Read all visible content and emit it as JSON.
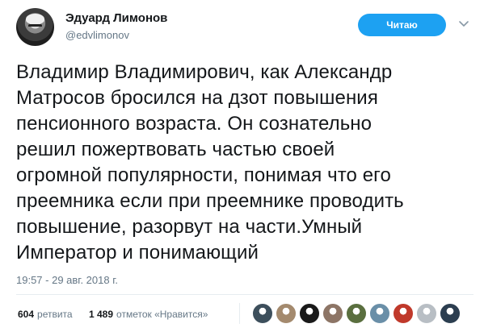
{
  "author": {
    "name": "Эдуард Лимонов",
    "handle": "@edvlimonov"
  },
  "follow_button": {
    "label": "Читаю",
    "color": "#1da1f2"
  },
  "tweet": {
    "lines": [
      "Владимир Владимирович, как Александр",
      "Матросов бросился на дзот повышения",
      "пенсионного возраста. Он сознательно",
      "решил пожертвовать частью своей",
      "огромной популярности, понимая что его",
      "преемника если при преемнике проводить",
      "повышение, разорвут на части.Умный",
      "Император и понимающий"
    ],
    "timestamp": "19:57 - 29 авг. 2018 г."
  },
  "stats": {
    "retweets_count": "604",
    "retweets_label": "ретвита",
    "likes_count": "1 489",
    "likes_label": "отметок «Нравится»"
  },
  "likers": [
    {
      "icon": "avatar-icon",
      "color": "#3d4f5c"
    },
    {
      "icon": "avatar-icon",
      "color": "#a48a6e"
    },
    {
      "icon": "avatar-icon",
      "color": "#1a1a1a"
    },
    {
      "icon": "avatar-icon",
      "color": "#8d7566"
    },
    {
      "icon": "avatar-icon",
      "color": "#5a6f3f"
    },
    {
      "icon": "avatar-icon",
      "color": "#6a8fa8"
    },
    {
      "icon": "avatar-icon",
      "color": "#c0392b"
    },
    {
      "icon": "avatar-icon",
      "color": "#b8bec4"
    },
    {
      "icon": "avatar-icon",
      "color": "#2c3e50"
    }
  ]
}
